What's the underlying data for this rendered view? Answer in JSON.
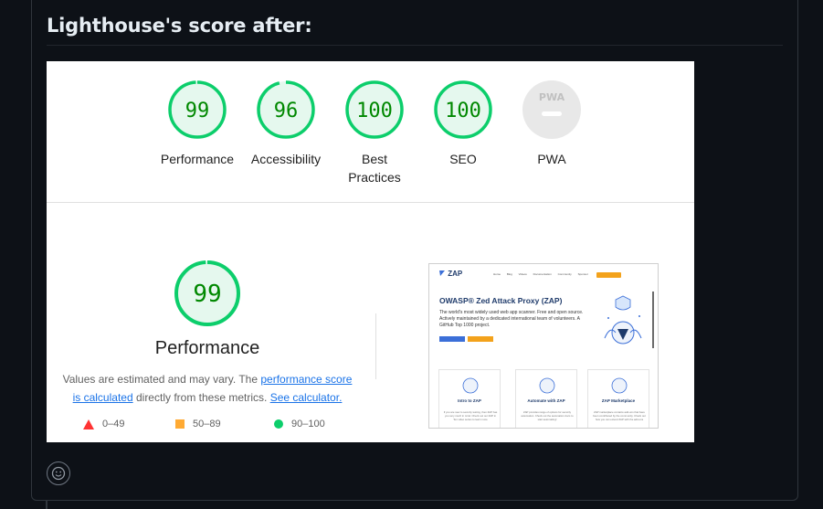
{
  "heading": "Lighthouse's score after:",
  "categories": [
    {
      "score": "99",
      "label": "Performance",
      "fraction": 0.99
    },
    {
      "score": "96",
      "label": "Accessibility",
      "fraction": 0.96
    },
    {
      "score": "100",
      "label_line1": "Best",
      "label_line2": "Practices",
      "fraction": 1.0
    },
    {
      "score": "100",
      "label": "SEO",
      "fraction": 1.0
    },
    {
      "score": "PWA",
      "label": "PWA",
      "fraction": 0
    }
  ],
  "performance": {
    "score": "99",
    "fraction": 0.99,
    "title": "Performance",
    "note_prefix": "Values are estimated and may vary. The ",
    "note_link": "performance score is calculated",
    "note_middle": " directly from these metrics. ",
    "note_link2": "See calculator."
  },
  "legend": [
    {
      "range": "0–49",
      "color": "#ff3333",
      "shape": "triangle"
    },
    {
      "range": "50–89",
      "color": "#ffaa33",
      "shape": "square"
    },
    {
      "range": "90–100",
      "color": "#0cce6b",
      "shape": "circle"
    }
  ],
  "screenshot": {
    "logo": "ZAP",
    "menu": "Home Blog Videos Documentation Community Sponsor",
    "hero_title": "OWASP® Zed Attack Proxy (ZAP)",
    "hero_text": "The world's most widely used web app scanner. Free and open source. Actively maintained by a dedicated international team of volunteers. A GitHub Top 1000 project.",
    "cards": [
      {
        "title": "Intro to ZAP",
        "text": "If you are new to security testing, then ZAP has you very much in mind. Check out our ZAP in Ten video series to learn more"
      },
      {
        "title": "Automate with ZAP",
        "text": "ZAP provides range of options for security automation. Check out the automation docs to start automating!"
      },
      {
        "title": "ZAP Marketplace",
        "text": "ZAP marketplace contains add-ons that have been contributed by the community. Check out how you can extend ZAP with the add-ons"
      }
    ]
  },
  "colors": {
    "pass": "#0cce6b",
    "pass_text": "#008800",
    "pass_bg": "#e5f8ee",
    "pwa_bg": "#e8e8e8",
    "link": "#1a73e8"
  },
  "icons": {
    "reaction": "smiley-icon",
    "pwa": "pwa-badge-icon"
  }
}
